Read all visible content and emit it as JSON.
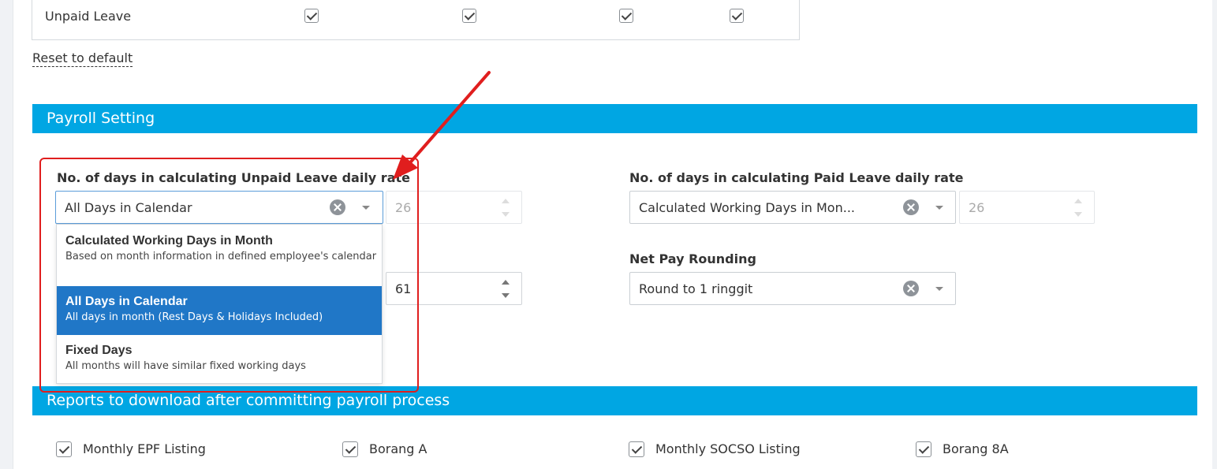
{
  "leave_table": {
    "row_label": "Unpaid Leave"
  },
  "reset_link": "Reset to default",
  "payroll_section": {
    "title": "Payroll Setting",
    "unpaid_leave": {
      "label": "No. of days in calculating Unpaid Leave daily rate",
      "selected": "All Days in Calendar",
      "days": "26"
    },
    "paid_leave": {
      "label": "No. of days in calculating Paid Leave daily rate",
      "selected": "Calculated Working Days in Mon...",
      "days": "26"
    },
    "hidden_field_value": "61",
    "net_pay_rounding": {
      "label": "Net Pay Rounding",
      "selected": "Round to 1 ringgit"
    },
    "dropdown_options": [
      {
        "title": "Calculated Working Days in Month",
        "description": "Based on month information in defined employee's calendar",
        "selected": false
      },
      {
        "title": "All Days in Calendar",
        "description": "All days in month (Rest Days & Holidays Included)",
        "selected": true
      },
      {
        "title": "Fixed Days",
        "description": "All months will have similar fixed working days",
        "selected": false
      }
    ]
  },
  "reports_section": {
    "title": "Reports to download after committing payroll process",
    "items": [
      {
        "label": "Monthly EPF Listing",
        "checked": true
      },
      {
        "label": "Borang A",
        "checked": true
      },
      {
        "label": "Monthly SOCSO Listing",
        "checked": true
      },
      {
        "label": "Borang 8A",
        "checked": true
      }
    ]
  },
  "colors": {
    "section_bar": "#00a6e3",
    "selected_option": "#2077c7",
    "annotation": "#e01e1e"
  }
}
